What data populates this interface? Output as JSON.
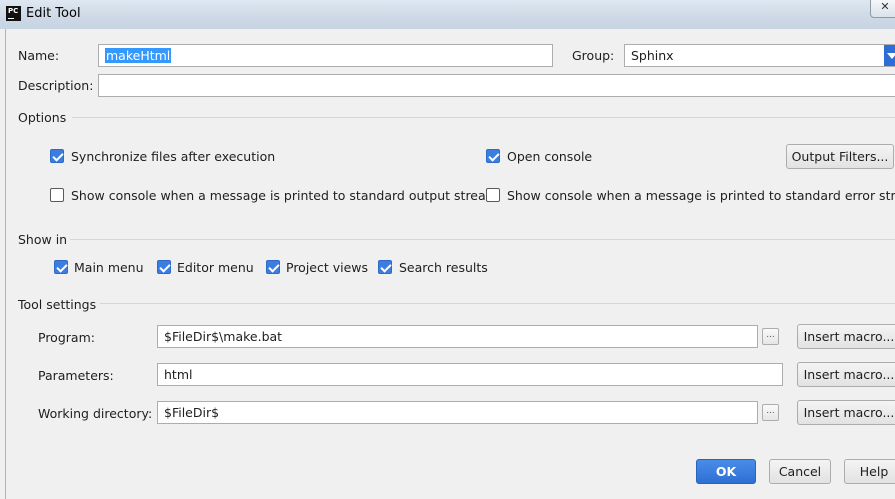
{
  "window": {
    "title": "Edit Tool",
    "app_icon_text": "PC",
    "close_glyph": "✕"
  },
  "form": {
    "name_label": "Name:",
    "name_value": "makeHtml",
    "group_label": "Group:",
    "group_value": "Sphinx",
    "description_label": "Description:",
    "description_value": ""
  },
  "options": {
    "heading": "Options",
    "sync_files": {
      "label": "Synchronize files after execution",
      "checked": true
    },
    "open_console": {
      "label": "Open console",
      "checked": true
    },
    "output_filters_label": "Output Filters...",
    "show_console_stdout": {
      "label": "Show console when a message is printed to standard output stream",
      "checked": false
    },
    "show_console_stderr": {
      "label": "Show console when a message is printed to standard error stream",
      "checked": false
    }
  },
  "show_in": {
    "heading": "Show in",
    "items": [
      {
        "label": "Main menu",
        "checked": true
      },
      {
        "label": "Editor menu",
        "checked": true
      },
      {
        "label": "Project views",
        "checked": true
      },
      {
        "label": "Search results",
        "checked": true
      }
    ]
  },
  "tool_settings": {
    "heading": "Tool settings",
    "program_label": "Program:",
    "program_value": "$FileDir$\\make.bat",
    "parameters_label": "Parameters:",
    "parameters_value": "html",
    "working_dir_label": "Working directory:",
    "working_dir_value": "$FileDir$",
    "browse_label": "...",
    "insert_macro_label": "Insert macro..."
  },
  "footer": {
    "ok_label": "OK",
    "cancel_label": "Cancel",
    "help_label": "Help"
  }
}
